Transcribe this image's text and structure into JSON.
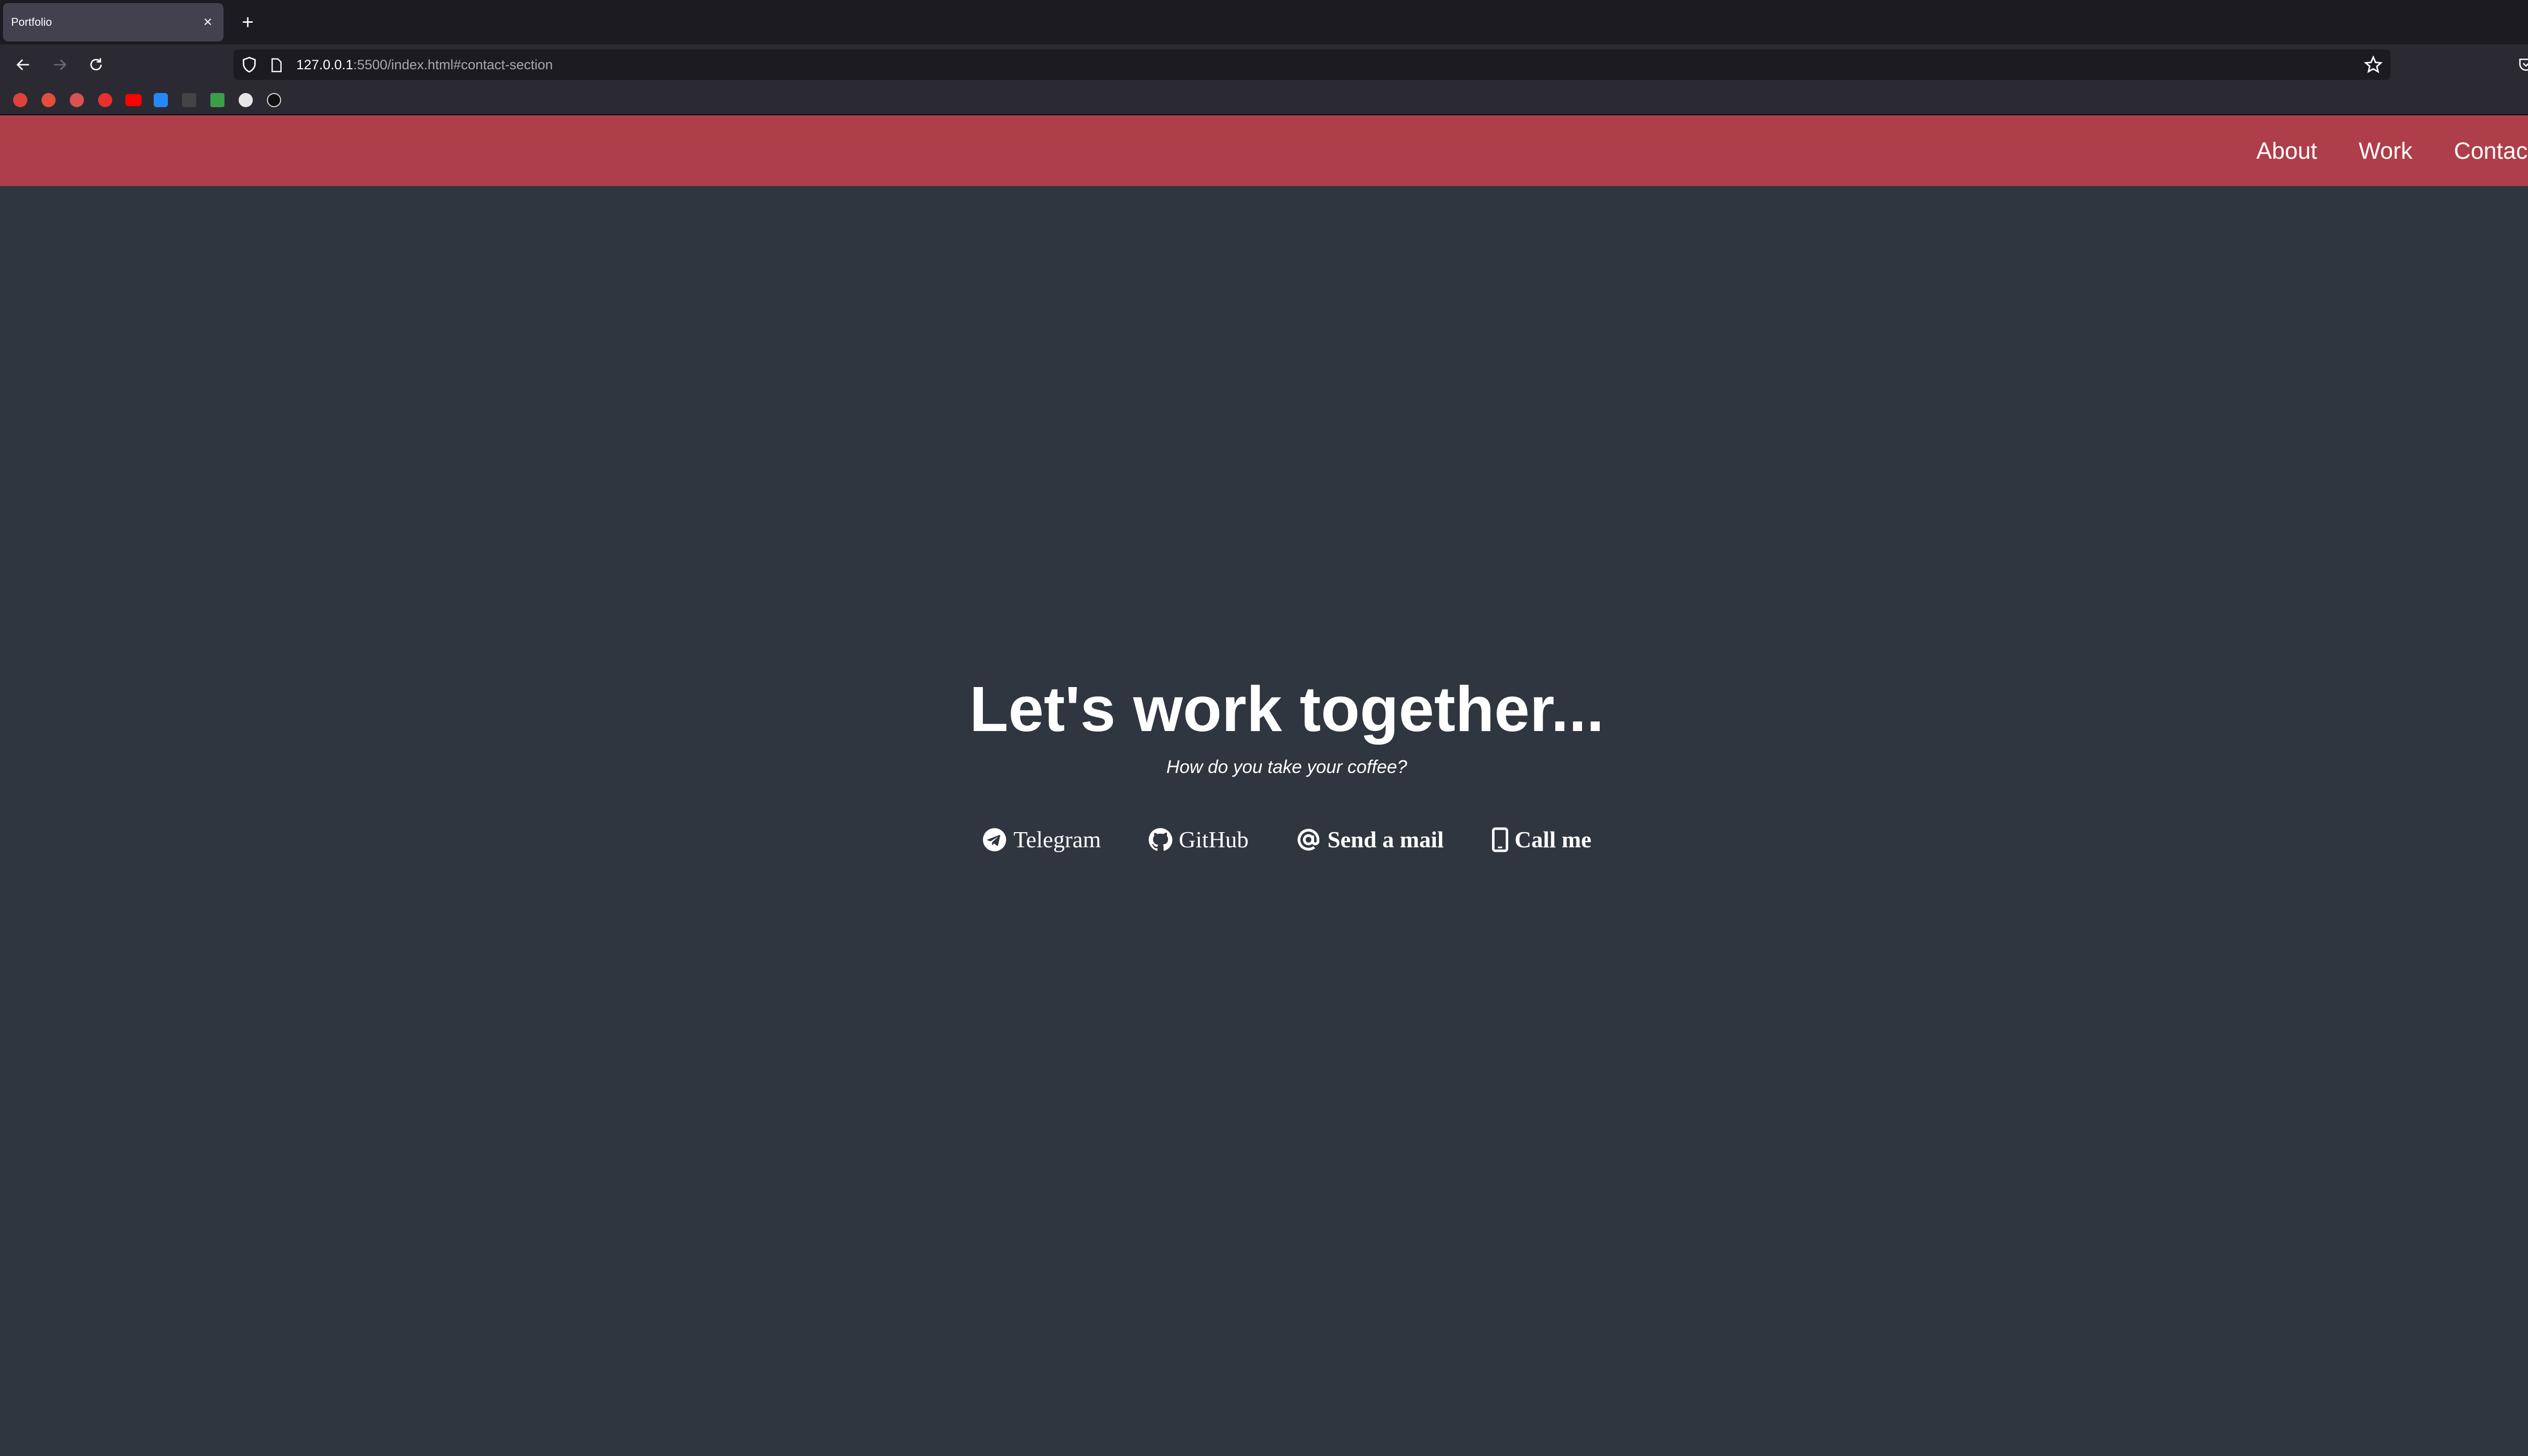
{
  "browser": {
    "tab_title": "Portfolio",
    "tab_close": "×",
    "new_tab": "+",
    "url_host": "127.0.0.1",
    "url_rest": ":5500/index.html#contact-section"
  },
  "site": {
    "nav": [
      "About",
      "Work",
      "Contact"
    ],
    "heading": "Let's work together...",
    "subtitle": "How do you take your coffee?",
    "links": [
      {
        "label": "Telegram",
        "icon": "telegram-icon"
      },
      {
        "label": "GitHub",
        "icon": "github-icon"
      },
      {
        "label": "Send a mail",
        "icon": "at-icon"
      },
      {
        "label": "Call me",
        "icon": "phone-icon"
      }
    ]
  },
  "colors": {
    "header": "#ae3e49",
    "page_bg": "#30363f",
    "chrome_dark": "#1c1b22",
    "chrome": "#2b2a33"
  }
}
